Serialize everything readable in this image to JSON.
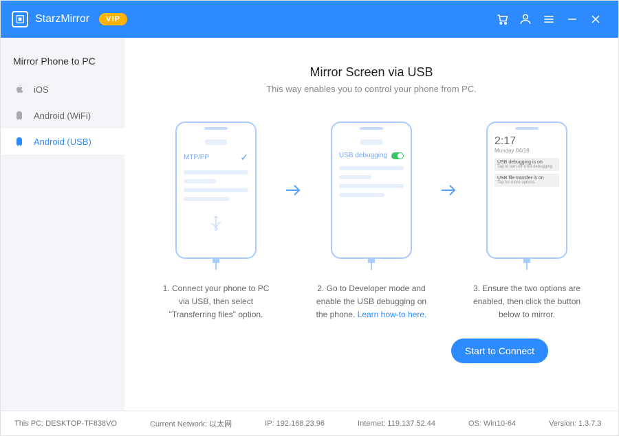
{
  "app": {
    "name": "StarzMirror",
    "badge": "VIP"
  },
  "sidebar": {
    "title": "Mirror Phone to PC",
    "items": [
      {
        "label": "iOS"
      },
      {
        "label": "Android (WiFi)"
      },
      {
        "label": "Android (USB)"
      }
    ]
  },
  "main": {
    "title": "Mirror Screen via USB",
    "subtitle": "This way enables you to control your phone from PC."
  },
  "phone1": {
    "row_label": "MTP/PP"
  },
  "phone2": {
    "row_label": "USB debugging"
  },
  "phone3": {
    "time": "2:17",
    "date": "Monday 04/18",
    "notif1_title": "USB debugging is on",
    "notif1_sub": "Tap to turn off USB debugging",
    "notif2_title": "USB file transfer is on",
    "notif2_sub": "Tap for more options"
  },
  "steps": {
    "s1": "1. Connect your phone to PC via USB, then select \"Transferring files\" option.",
    "s2_prefix": "2. Go to Developer mode and enable the USB debugging on the phone. ",
    "s2_link": "Learn how-to here.",
    "s3": "3. Ensure the two options are enabled, then click the button below to mirror."
  },
  "cta": "Start to Connect",
  "status": {
    "pc": "This PC: DESKTOP-TF838VO",
    "network": "Current Network: 以太网",
    "ip": "IP: 192.168.23.96",
    "internet": "Internet: 119.137.52.44",
    "os": "OS: Win10-64",
    "version": "Version: 1.3.7.3"
  }
}
